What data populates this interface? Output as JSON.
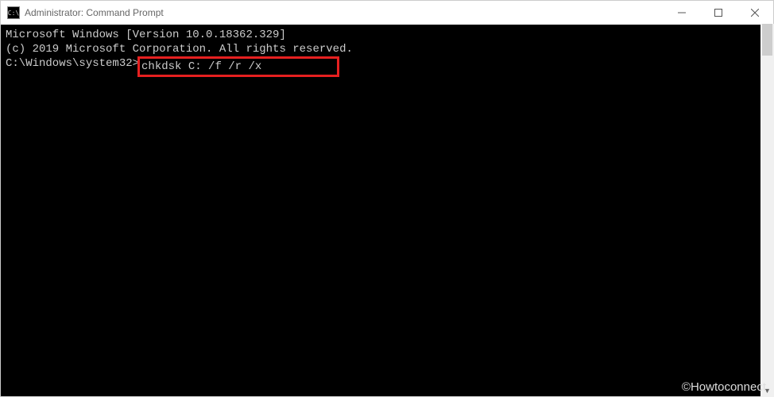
{
  "titlebar": {
    "app_icon_label": "C:\\",
    "title": "Administrator: Command Prompt"
  },
  "terminal": {
    "line1": "Microsoft Windows [Version 10.0.18362.329]",
    "line2": "(c) 2019 Microsoft Corporation. All rights reserved.",
    "blank": "",
    "prompt": "C:\\Windows\\system32>",
    "command": "chkdsk C: /f /r /x"
  },
  "watermark": "©Howtoconnect",
  "icons": {
    "minimize": "minimize",
    "maximize": "maximize",
    "close": "close"
  }
}
